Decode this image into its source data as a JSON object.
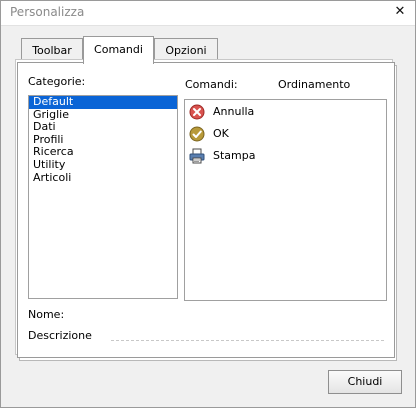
{
  "window": {
    "title": "Personalizza",
    "close_glyph": "✕"
  },
  "tabs": [
    {
      "label": "Toolbar",
      "active": false
    },
    {
      "label": "Comandi",
      "active": true
    },
    {
      "label": "Opzioni",
      "active": false
    }
  ],
  "categories": {
    "label": "Categorie:",
    "items": [
      "Default",
      "Griglie",
      "Dati",
      "Profili",
      "Ricerca",
      "Utility",
      "Articoli"
    ],
    "selected": "Default"
  },
  "commands": {
    "label": "Comandi:",
    "sort_label": "Ordinamento",
    "items": [
      {
        "label": "Annulla",
        "icon": "cancel-icon"
      },
      {
        "label": "OK",
        "icon": "ok-icon"
      },
      {
        "label": "Stampa",
        "icon": "printer-icon"
      }
    ]
  },
  "details": {
    "name_label": "Nome:",
    "description_label": "Descrizione"
  },
  "footer": {
    "close_label": "Chiudi"
  },
  "colors": {
    "selection": "#0a64d6",
    "cancel_red": "#d9534f",
    "ok_olive": "#b89a3a"
  }
}
